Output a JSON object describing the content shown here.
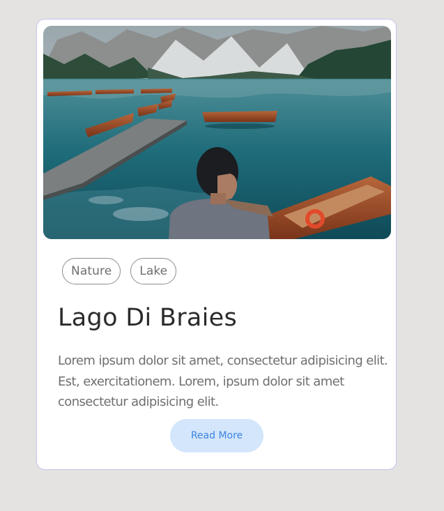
{
  "card": {
    "image": {
      "alt_subject": "mountain-lake-photo"
    },
    "tags": [
      "Nature",
      "Lake"
    ],
    "title": "Lago Di Braies",
    "description": "Lorem ipsum dolor sit amet, consectetur adipisicing elit. Est, exercitationem. Lorem, ipsum dolor sit amet consectetur adipisicing elit.",
    "button_label": "Read More"
  },
  "colors": {
    "page_background": "#e4e3e2",
    "card_border": "#c5c4ef",
    "button_background": "#d4e6fc",
    "button_text": "#3d84e0"
  }
}
